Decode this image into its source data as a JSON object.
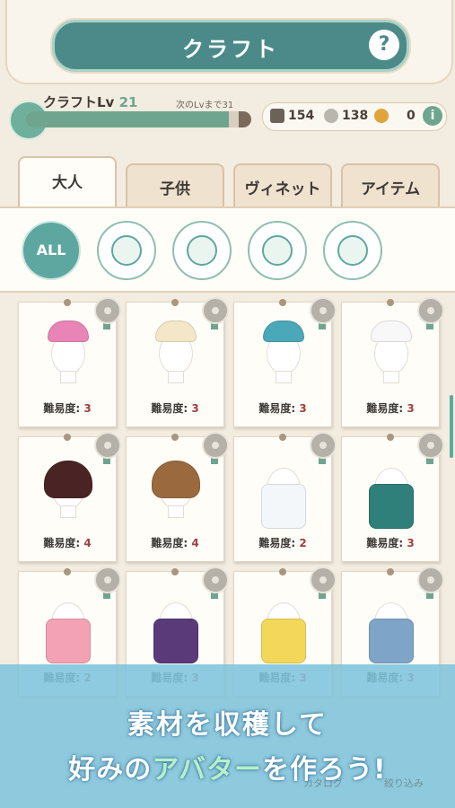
{
  "header": {
    "title": "クラフト",
    "help_label": "?"
  },
  "level": {
    "label": "クラフトLv",
    "value": "21",
    "next_label": "次のLvまで31",
    "progress": 0.9
  },
  "resources": [
    {
      "name": "hammer-icon",
      "count": "154",
      "color": "#6b625a"
    },
    {
      "name": "silver-medal-icon",
      "count": "138",
      "color": "#b9b6ae"
    },
    {
      "name": "gold-medal-icon",
      "count": "0",
      "color": "#e0a43c"
    }
  ],
  "info_label": "i",
  "tabs": [
    {
      "label": "大人",
      "active": true
    },
    {
      "label": "子供",
      "active": false
    },
    {
      "label": "ヴィネット",
      "active": false
    },
    {
      "label": "アイテム",
      "active": false
    }
  ],
  "filters": [
    {
      "label": "ALL",
      "icon": "all"
    },
    {
      "label": "",
      "icon": "mannequin-icon"
    },
    {
      "label": "",
      "icon": "bag-icon"
    },
    {
      "label": "",
      "icon": "face-icon"
    },
    {
      "label": "",
      "icon": "sparkle-icon"
    }
  ],
  "difficulty_label": "難易度:",
  "items": [
    {
      "name": "pink-bird-hat",
      "difficulty": "3",
      "color": "#e885b6"
    },
    {
      "name": "bear-ear-headband",
      "difficulty": "3",
      "color": "#f3e7c8"
    },
    {
      "name": "blue-bird-hat",
      "difficulty": "3",
      "color": "#4aa8b8"
    },
    {
      "name": "white-bear-headband",
      "difficulty": "3",
      "color": "#f8f8f8"
    },
    {
      "name": "brown-bob-wig",
      "difficulty": "4",
      "color": "#4a2424"
    },
    {
      "name": "brown-short-wig",
      "difficulty": "4",
      "color": "#9a6a3e"
    },
    {
      "name": "white-graphic-tee",
      "difficulty": "2",
      "color": "#f4f7fa"
    },
    {
      "name": "green-cardigan",
      "difficulty": "3",
      "color": "#2f7f7a"
    },
    {
      "name": "pink-graphic-tee",
      "difficulty": "2",
      "color": "#f2a2b4"
    },
    {
      "name": "purple-cardigan",
      "difficulty": "3",
      "color": "#5a3a78"
    },
    {
      "name": "yellow-hoodie",
      "difficulty": "3",
      "color": "#f3d75a"
    },
    {
      "name": "blue-jeans",
      "difficulty": "3",
      "color": "#7ea4c8"
    }
  ],
  "banner": {
    "line1": "素材を収穫して",
    "line2_a": "好みの",
    "line2_accent": "アバター",
    "line2_b": "を作ろう!"
  },
  "bottom": {
    "catalog_label": "カタログ",
    "filter_label": "絞り込み"
  }
}
